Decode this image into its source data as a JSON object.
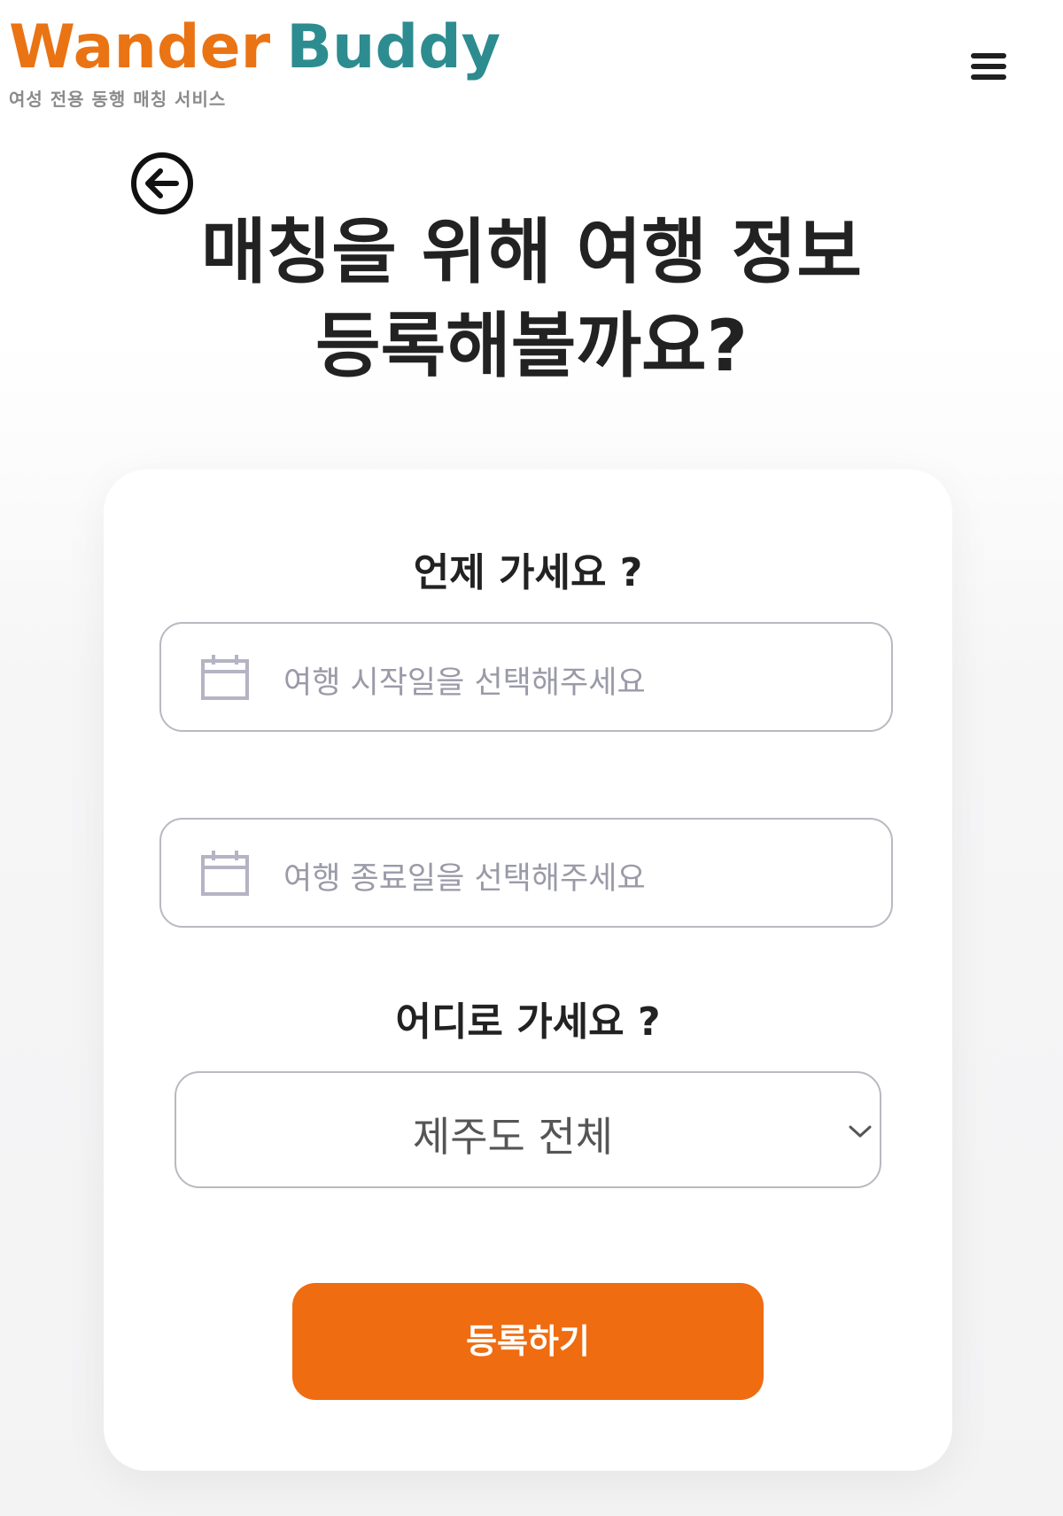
{
  "header": {
    "logo_part1": "Wander",
    "logo_part2": "Buddy",
    "tagline": "여성 전용 동행 매칭 서비스",
    "menu_icon": "hamburger-menu-icon"
  },
  "back": {
    "icon": "arrow-left-circle-icon"
  },
  "headline": {
    "line1": "매칭을 위해 여행 정보",
    "line2": "등록해볼까요?"
  },
  "when": {
    "title": "언제 가세요 ?",
    "start_placeholder": "여행 시작일을 선택해주세요",
    "end_placeholder": "여행 종료일을 선택해주세요",
    "icon": "calendar-icon"
  },
  "where": {
    "title": "어디로 가세요 ?",
    "selected": "제주도 전체",
    "icon": "chevron-down-icon"
  },
  "submit": {
    "label": "등록하기"
  },
  "colors": {
    "brand_orange": "#ea7314",
    "brand_teal": "#2d8c8f",
    "button_orange": "#ef6c11"
  }
}
